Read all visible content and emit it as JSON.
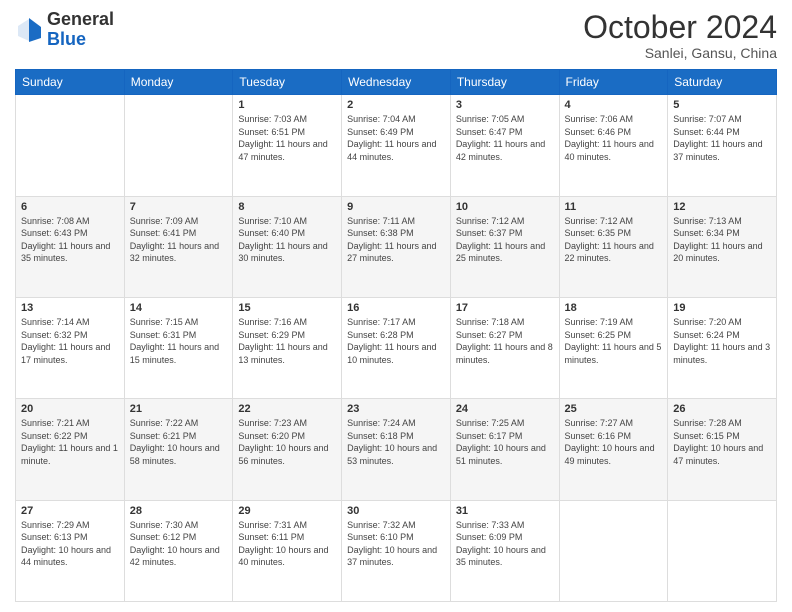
{
  "header": {
    "logo_general": "General",
    "logo_blue": "Blue",
    "month_title": "October 2024",
    "location": "Sanlei, Gansu, China"
  },
  "days_of_week": [
    "Sunday",
    "Monday",
    "Tuesday",
    "Wednesday",
    "Thursday",
    "Friday",
    "Saturday"
  ],
  "weeks": [
    [
      null,
      null,
      {
        "day": "1",
        "sunrise": "Sunrise: 7:03 AM",
        "sunset": "Sunset: 6:51 PM",
        "daylight": "Daylight: 11 hours and 47 minutes."
      },
      {
        "day": "2",
        "sunrise": "Sunrise: 7:04 AM",
        "sunset": "Sunset: 6:49 PM",
        "daylight": "Daylight: 11 hours and 44 minutes."
      },
      {
        "day": "3",
        "sunrise": "Sunrise: 7:05 AM",
        "sunset": "Sunset: 6:47 PM",
        "daylight": "Daylight: 11 hours and 42 minutes."
      },
      {
        "day": "4",
        "sunrise": "Sunrise: 7:06 AM",
        "sunset": "Sunset: 6:46 PM",
        "daylight": "Daylight: 11 hours and 40 minutes."
      },
      {
        "day": "5",
        "sunrise": "Sunrise: 7:07 AM",
        "sunset": "Sunset: 6:44 PM",
        "daylight": "Daylight: 11 hours and 37 minutes."
      }
    ],
    [
      {
        "day": "6",
        "sunrise": "Sunrise: 7:08 AM",
        "sunset": "Sunset: 6:43 PM",
        "daylight": "Daylight: 11 hours and 35 minutes."
      },
      {
        "day": "7",
        "sunrise": "Sunrise: 7:09 AM",
        "sunset": "Sunset: 6:41 PM",
        "daylight": "Daylight: 11 hours and 32 minutes."
      },
      {
        "day": "8",
        "sunrise": "Sunrise: 7:10 AM",
        "sunset": "Sunset: 6:40 PM",
        "daylight": "Daylight: 11 hours and 30 minutes."
      },
      {
        "day": "9",
        "sunrise": "Sunrise: 7:11 AM",
        "sunset": "Sunset: 6:38 PM",
        "daylight": "Daylight: 11 hours and 27 minutes."
      },
      {
        "day": "10",
        "sunrise": "Sunrise: 7:12 AM",
        "sunset": "Sunset: 6:37 PM",
        "daylight": "Daylight: 11 hours and 25 minutes."
      },
      {
        "day": "11",
        "sunrise": "Sunrise: 7:12 AM",
        "sunset": "Sunset: 6:35 PM",
        "daylight": "Daylight: 11 hours and 22 minutes."
      },
      {
        "day": "12",
        "sunrise": "Sunrise: 7:13 AM",
        "sunset": "Sunset: 6:34 PM",
        "daylight": "Daylight: 11 hours and 20 minutes."
      }
    ],
    [
      {
        "day": "13",
        "sunrise": "Sunrise: 7:14 AM",
        "sunset": "Sunset: 6:32 PM",
        "daylight": "Daylight: 11 hours and 17 minutes."
      },
      {
        "day": "14",
        "sunrise": "Sunrise: 7:15 AM",
        "sunset": "Sunset: 6:31 PM",
        "daylight": "Daylight: 11 hours and 15 minutes."
      },
      {
        "day": "15",
        "sunrise": "Sunrise: 7:16 AM",
        "sunset": "Sunset: 6:29 PM",
        "daylight": "Daylight: 11 hours and 13 minutes."
      },
      {
        "day": "16",
        "sunrise": "Sunrise: 7:17 AM",
        "sunset": "Sunset: 6:28 PM",
        "daylight": "Daylight: 11 hours and 10 minutes."
      },
      {
        "day": "17",
        "sunrise": "Sunrise: 7:18 AM",
        "sunset": "Sunset: 6:27 PM",
        "daylight": "Daylight: 11 hours and 8 minutes."
      },
      {
        "day": "18",
        "sunrise": "Sunrise: 7:19 AM",
        "sunset": "Sunset: 6:25 PM",
        "daylight": "Daylight: 11 hours and 5 minutes."
      },
      {
        "day": "19",
        "sunrise": "Sunrise: 7:20 AM",
        "sunset": "Sunset: 6:24 PM",
        "daylight": "Daylight: 11 hours and 3 minutes."
      }
    ],
    [
      {
        "day": "20",
        "sunrise": "Sunrise: 7:21 AM",
        "sunset": "Sunset: 6:22 PM",
        "daylight": "Daylight: 11 hours and 1 minute."
      },
      {
        "day": "21",
        "sunrise": "Sunrise: 7:22 AM",
        "sunset": "Sunset: 6:21 PM",
        "daylight": "Daylight: 10 hours and 58 minutes."
      },
      {
        "day": "22",
        "sunrise": "Sunrise: 7:23 AM",
        "sunset": "Sunset: 6:20 PM",
        "daylight": "Daylight: 10 hours and 56 minutes."
      },
      {
        "day": "23",
        "sunrise": "Sunrise: 7:24 AM",
        "sunset": "Sunset: 6:18 PM",
        "daylight": "Daylight: 10 hours and 53 minutes."
      },
      {
        "day": "24",
        "sunrise": "Sunrise: 7:25 AM",
        "sunset": "Sunset: 6:17 PM",
        "daylight": "Daylight: 10 hours and 51 minutes."
      },
      {
        "day": "25",
        "sunrise": "Sunrise: 7:27 AM",
        "sunset": "Sunset: 6:16 PM",
        "daylight": "Daylight: 10 hours and 49 minutes."
      },
      {
        "day": "26",
        "sunrise": "Sunrise: 7:28 AM",
        "sunset": "Sunset: 6:15 PM",
        "daylight": "Daylight: 10 hours and 47 minutes."
      }
    ],
    [
      {
        "day": "27",
        "sunrise": "Sunrise: 7:29 AM",
        "sunset": "Sunset: 6:13 PM",
        "daylight": "Daylight: 10 hours and 44 minutes."
      },
      {
        "day": "28",
        "sunrise": "Sunrise: 7:30 AM",
        "sunset": "Sunset: 6:12 PM",
        "daylight": "Daylight: 10 hours and 42 minutes."
      },
      {
        "day": "29",
        "sunrise": "Sunrise: 7:31 AM",
        "sunset": "Sunset: 6:11 PM",
        "daylight": "Daylight: 10 hours and 40 minutes."
      },
      {
        "day": "30",
        "sunrise": "Sunrise: 7:32 AM",
        "sunset": "Sunset: 6:10 PM",
        "daylight": "Daylight: 10 hours and 37 minutes."
      },
      {
        "day": "31",
        "sunrise": "Sunrise: 7:33 AM",
        "sunset": "Sunset: 6:09 PM",
        "daylight": "Daylight: 10 hours and 35 minutes."
      },
      null,
      null
    ]
  ]
}
